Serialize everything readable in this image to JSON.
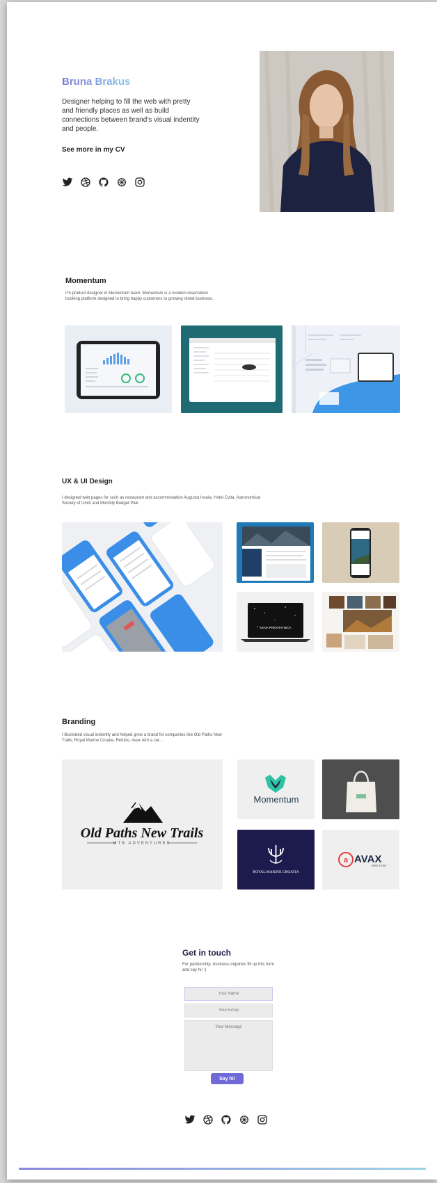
{
  "hero": {
    "name": "Bruna Brakus",
    "description": "Designer helping to fill the web with pretty and friendly places as well as build connections between brand's visual indentity and people.",
    "cv_link": "See more in my CV"
  },
  "social_icons": [
    "twitter-icon",
    "dribbble-icon",
    "github-icon",
    "behance-icon",
    "instagram-icon"
  ],
  "momentum": {
    "title": "Momentum",
    "description": "I'm product designer in Momentum team. Momentum is a modern reservation booking platform designed to bring happy customers to growing rental business."
  },
  "uxui": {
    "title": "UX & UI Design",
    "description": "I designed web pages for  such as restaurant and accommodation Augusta Insula, Hotel Cvita, Astronomical Society of Umiš and Monthly Budget Plek"
  },
  "branding": {
    "title": "Branding",
    "description": "I illustrated visual indentity and helped grow a brand for companies like Old Paths New Trails, Royal Marine Croatia, Refubo, Avax rent a car...",
    "logos": {
      "oldpaths_title": "Old Paths New Trails",
      "oldpaths_sub": "MTB ADVENTURES",
      "momentum": "Momentum",
      "royal": "ROYAL MARINE CROATIA",
      "avax": "AVAX",
      "avax_sub": "RENT A CAR"
    }
  },
  "mockup_text": {
    "nova": "NOVA PREKRATNICA"
  },
  "contact": {
    "title": "Get in touch",
    "description": "For partnership, business inquiries fill up this form and say hi! :)",
    "name_placeholder": "Your Name",
    "email_placeholder": "Your Email",
    "message_placeholder": "Your Message",
    "submit": "Say hi!"
  },
  "colors": {
    "accent": "#6f6ad8",
    "teal": "#1f6b74",
    "navy": "#1d1a4d",
    "blue": "#3b8ee8"
  }
}
